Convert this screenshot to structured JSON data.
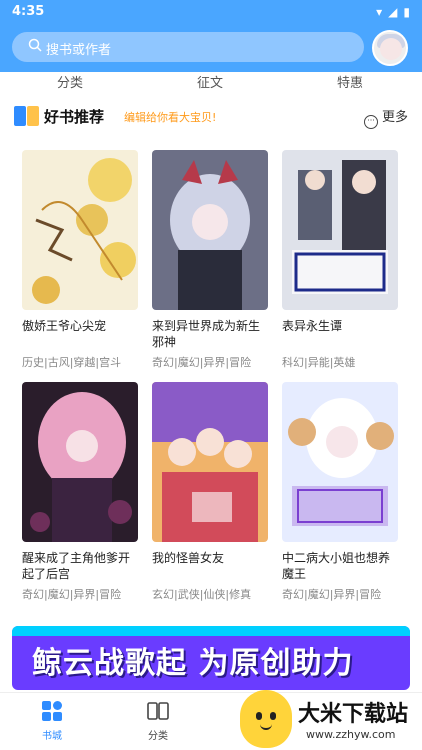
{
  "status": {
    "time": "4:35"
  },
  "search": {
    "placeholder": "搜书或作者"
  },
  "nav": {
    "items": [
      "分类",
      "征文",
      "特惠"
    ]
  },
  "section": {
    "title": "好书推荐",
    "subtitle": "编辑给你看大宝贝!",
    "more": "更多"
  },
  "books": [
    {
      "title": "傲娇王爷心尖宠",
      "tags": "历史|古风|穿越|宫斗",
      "cover_colors": [
        "#f6efd9",
        "#e8c35a"
      ]
    },
    {
      "title": "来到异世界成为新生邪神",
      "tags": "奇幻|魔幻|异界|冒险",
      "cover_colors": [
        "#6c6f86",
        "#cfd3e6"
      ]
    },
    {
      "title": "表异永生谭",
      "tags": "科幻|异能|英雄",
      "cover_colors": [
        "#dfe2ea",
        "#1d2b8a"
      ]
    },
    {
      "title": "醒来成了主角他爹开起了后宫",
      "tags": "奇幻|魔幻|异界|冒险",
      "cover_colors": [
        "#2a1d2b",
        "#e9a2c3"
      ]
    },
    {
      "title": "我的怪兽女友",
      "tags": "玄幻|武侠|仙侠|修真",
      "cover_colors": [
        "#f0b36a",
        "#8a5bc7"
      ]
    },
    {
      "title": "中二病大小姐也想养魔王",
      "tags": "奇幻|魔幻|异界|冒险",
      "cover_colors": [
        "#e6ecff",
        "#c9b8f0"
      ]
    }
  ],
  "banner": {
    "text": "鲸云战歌起 为原创助力"
  },
  "tabbar": {
    "items": [
      {
        "label": "书城",
        "active": true
      },
      {
        "label": "分类",
        "active": false
      }
    ]
  },
  "watermark": {
    "name": "大米下载站",
    "url": "www.zzhyw.com"
  },
  "colors": {
    "accent": "#4aa6ff",
    "active_tab": "#2f8cff",
    "subtitle_orange": "#ff9a1a"
  }
}
